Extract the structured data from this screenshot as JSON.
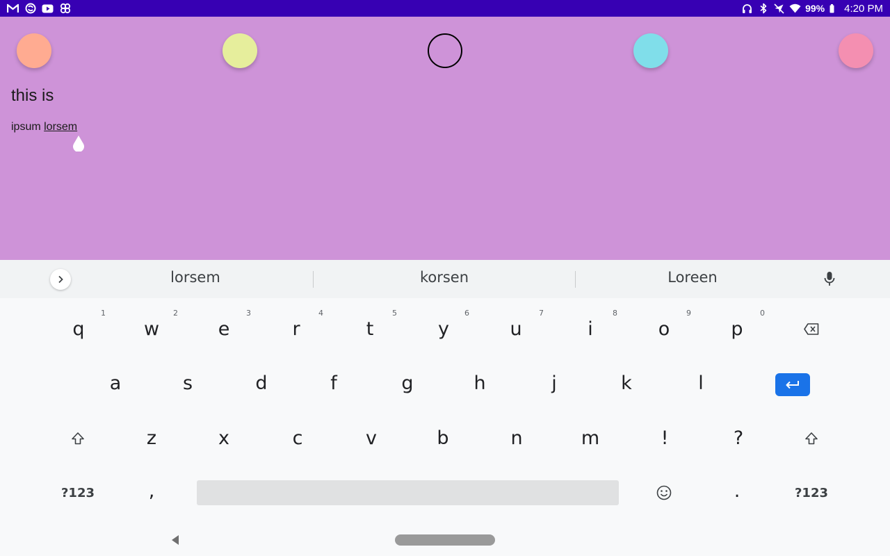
{
  "status_bar": {
    "left_icons": [
      "gmail-icon",
      "sync-icon",
      "youtube-icon",
      "pinwheel-icon"
    ],
    "right_icons": [
      "headphones-icon",
      "bluetooth-icon",
      "location-off-icon",
      "wifi-icon"
    ],
    "battery_percent": "99%",
    "time": "4:20 PM",
    "background": "#3700b3"
  },
  "app": {
    "background": "#ce93d8",
    "swatches": [
      {
        "name": "orange",
        "color": "#ffab91",
        "selected": false
      },
      {
        "name": "yellow",
        "color": "#e6ee9c",
        "selected": false
      },
      {
        "name": "purple",
        "color": "#ce93d8",
        "selected": true
      },
      {
        "name": "cyan",
        "color": "#80deea",
        "selected": false
      },
      {
        "name": "pink",
        "color": "#f48fb1",
        "selected": false
      }
    ],
    "heading": "this is",
    "body_prefix": "ipsum ",
    "body_composing": "lorsem"
  },
  "keyboard": {
    "suggestions": [
      "lorsem",
      "korsen",
      "Loreen"
    ],
    "row1": [
      "q",
      "w",
      "e",
      "r",
      "t",
      "y",
      "u",
      "i",
      "o",
      "p"
    ],
    "row1_hints": [
      "1",
      "2",
      "3",
      "4",
      "5",
      "6",
      "7",
      "8",
      "9",
      "0"
    ],
    "row2": [
      "a",
      "s",
      "d",
      "f",
      "g",
      "h",
      "j",
      "k",
      "l"
    ],
    "row3": [
      "z",
      "x",
      "c",
      "v",
      "b",
      "n",
      "m",
      "!",
      "?"
    ],
    "row4": {
      "symbols_left": "?123",
      "comma": ",",
      "period": ".",
      "symbols_right": "?123"
    },
    "accent": "#1a73e8"
  },
  "nav_bar": {
    "icons": [
      "back-icon",
      "home-pill"
    ]
  }
}
